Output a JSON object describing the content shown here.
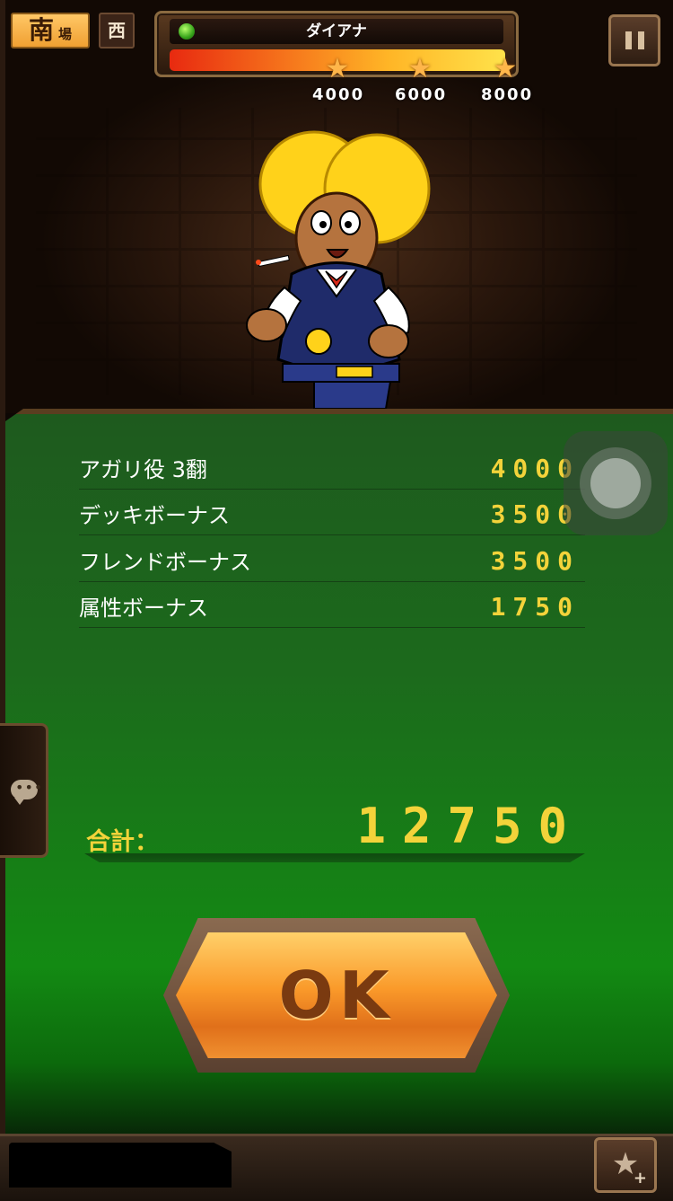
{
  "header": {
    "round_wind": "南",
    "round_suffix": "場",
    "seat_wind": "西",
    "enemy_name": "ダイアナ",
    "score_progress_fraction": 1.0,
    "thresholds": [
      "4000",
      "6000",
      "8000"
    ]
  },
  "results": {
    "rows": [
      {
        "label": "アガリ役 3翻",
        "value": "4000"
      },
      {
        "label": "デッキボーナス",
        "value": "3500"
      },
      {
        "label": "フレンドボーナス",
        "value": "3500"
      },
      {
        "label": "属性ボーナス",
        "value": "1750"
      }
    ],
    "total_label": "合計：",
    "total_value": "12750"
  },
  "ok_label": "OK",
  "icons": {
    "pause": "pause-icon",
    "chat": "chat-icon",
    "favorite": "star-plus-icon",
    "threshold_marker": "star-icon",
    "status": "green-dot-icon"
  },
  "colors": {
    "gold_text": "#f3d33a",
    "panel_green": "#138a13",
    "ok_orange": "#fa9a2a"
  }
}
